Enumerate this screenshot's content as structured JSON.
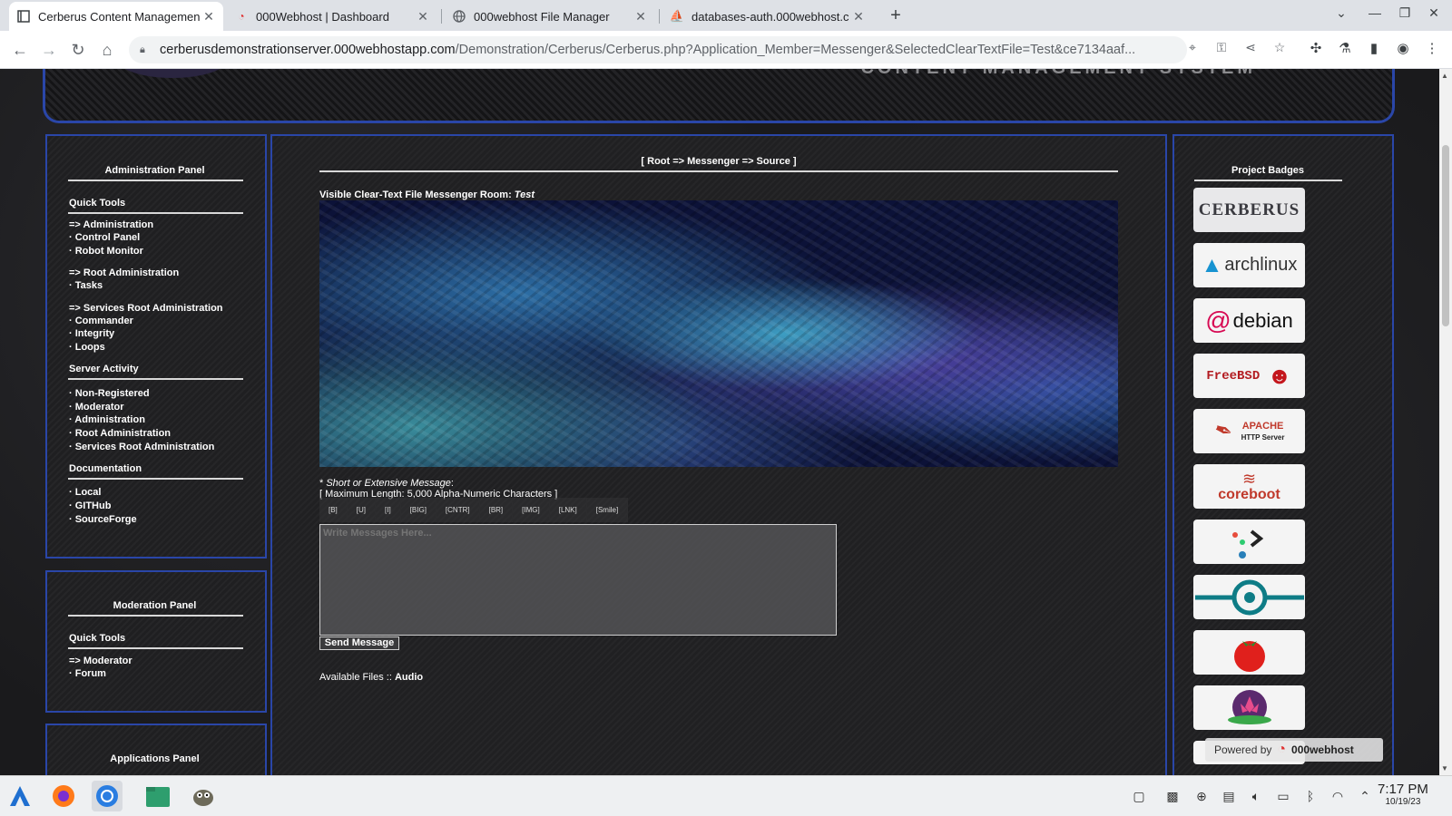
{
  "browser": {
    "tabs": [
      {
        "title": "Cerberus Content Managemen",
        "icon": "page-icon",
        "active": true
      },
      {
        "title": "000Webhost | Dashboard",
        "icon": "000webhost-icon",
        "active": false
      },
      {
        "title": "000webhost File Manager",
        "icon": "globe-icon",
        "active": false
      },
      {
        "title": "databases-auth.000webhost.c",
        "icon": "phpmyadmin-icon",
        "active": false
      }
    ],
    "url_host": "cerberusdemonstrationserver.000webhostapp.com",
    "url_path": "/Demonstration/Cerberus/Cerberus.php?Application_Member=Messenger&SelectedClearTextFile=Test&ce7134aaf..."
  },
  "banner": {
    "logo_text": "CONTENT MANAGEMENT SYSTEM"
  },
  "admin_panel": {
    "title": "Administration Panel",
    "quick_tools_title": "Quick Tools",
    "quick_tools": [
      "=> Administration",
      "· Control Panel",
      "· Robot Monitor"
    ],
    "root_admin": [
      "=> Root Administration",
      "· Tasks"
    ],
    "services_root": [
      "=> Services Root Administration",
      "· Commander",
      "· Integrity",
      "· Loops"
    ],
    "server_activity_title": "Server Activity",
    "server_activity": [
      "· Non-Registered",
      "· Moderator",
      "· Administration",
      "· Root Administration",
      "· Services Root Administration"
    ],
    "documentation_title": "Documentation",
    "documentation": [
      "· Local",
      "· GITHub",
      "· SourceForge"
    ]
  },
  "moderation_panel": {
    "title": "Moderation Panel",
    "quick_tools_title": "Quick Tools",
    "quick_tools": [
      "=> Moderator",
      "· Forum"
    ]
  },
  "applications_panel": {
    "title": "Applications Panel"
  },
  "main": {
    "breadcrumb": "[ Root => Messenger => Source ]",
    "room_label": "Visible Clear-Text File Messenger Room",
    "room_name": "Test",
    "message_label": "Short or Extensive Message",
    "max_length": "[ Maximum Length: 5,000 Alpha-Numeric Characters ]",
    "format_buttons": [
      "[B]",
      "[U]",
      "[I]",
      "[BIG]",
      "[CNTR]",
      "[BR]",
      "[IMG]",
      "[LNK]",
      "[Smile]"
    ],
    "message_placeholder": "Write Messages Here...",
    "send_label": "Send Message",
    "files_label": "Available Files ::",
    "files_link": "Audio"
  },
  "badges_panel": {
    "title": "Project Badges",
    "badges": [
      "CERBERUS",
      "archlinux",
      "debian",
      "FreeBSD",
      "APACHE",
      "HTTP Server",
      "coreboot",
      "",
      "",
      "",
      ""
    ]
  },
  "powered_by": {
    "label": "Powered by",
    "brand": "000webhost"
  },
  "taskbar": {
    "time": "7:17 PM",
    "date": "10/19/23"
  },
  "colors": {
    "panel_border": "#2a46a8",
    "page_bg": "#1a1a1c"
  }
}
